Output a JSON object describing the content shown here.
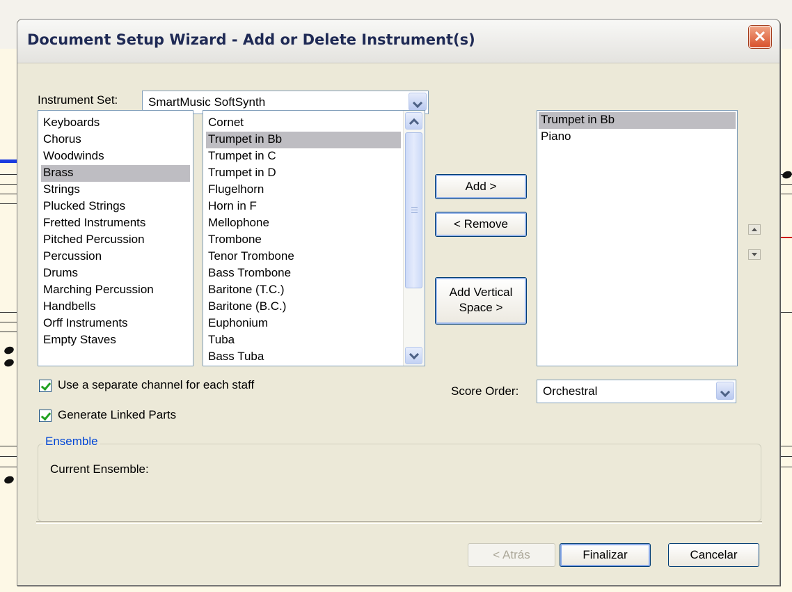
{
  "window": {
    "title": "Document Setup Wizard - Add or Delete Instrument(s)",
    "close_glyph": "✕"
  },
  "instrument_set": {
    "label": "Instrument Set:",
    "value": "SmartMusic SoftSynth"
  },
  "categories": [
    {
      "label": "Keyboards",
      "selected": false
    },
    {
      "label": "Chorus",
      "selected": false
    },
    {
      "label": "Woodwinds",
      "selected": false
    },
    {
      "label": "Brass",
      "selected": true
    },
    {
      "label": "Strings",
      "selected": false
    },
    {
      "label": "Plucked Strings",
      "selected": false
    },
    {
      "label": "Fretted Instruments",
      "selected": false
    },
    {
      "label": "Pitched Percussion",
      "selected": false
    },
    {
      "label": "Percussion",
      "selected": false
    },
    {
      "label": "Drums",
      "selected": false
    },
    {
      "label": "Marching Percussion",
      "selected": false
    },
    {
      "label": "Handbells",
      "selected": false
    },
    {
      "label": "Orff Instruments",
      "selected": false
    },
    {
      "label": "Empty Staves",
      "selected": false
    }
  ],
  "instruments": [
    {
      "label": "Cornet",
      "selected": false
    },
    {
      "label": "Trumpet in Bb",
      "selected": true
    },
    {
      "label": "Trumpet in C",
      "selected": false
    },
    {
      "label": "Trumpet in D",
      "selected": false
    },
    {
      "label": "Flugelhorn",
      "selected": false
    },
    {
      "label": "Horn in F",
      "selected": false
    },
    {
      "label": "Mellophone",
      "selected": false
    },
    {
      "label": "Trombone",
      "selected": false
    },
    {
      "label": "Tenor Trombone",
      "selected": false
    },
    {
      "label": "Bass Trombone",
      "selected": false
    },
    {
      "label": "Baritone (T.C.)",
      "selected": false
    },
    {
      "label": "Baritone (B.C.)",
      "selected": false
    },
    {
      "label": "Euphonium",
      "selected": false
    },
    {
      "label": "Tuba",
      "selected": false
    },
    {
      "label": "Bass Tuba",
      "selected": false
    }
  ],
  "score_instruments": [
    {
      "label": "Trumpet in Bb",
      "selected": true
    },
    {
      "label": "Piano",
      "selected": false
    }
  ],
  "buttons": {
    "add": "Add >",
    "remove": "< Remove",
    "add_vertical_line1": "Add Vertical",
    "add_vertical_line2": "Space >",
    "back": "< Atrás",
    "finish": "Finalizar",
    "cancel": "Cancelar"
  },
  "options": {
    "separate_channel": {
      "label": "Use a separate channel for each staff",
      "checked": true
    },
    "linked_parts": {
      "label": "Generate Linked Parts",
      "checked": true
    }
  },
  "score_order": {
    "label": "Score Order:",
    "value": "Orchestral"
  },
  "ensemble": {
    "legend": "Ensemble",
    "current_label": "Current Ensemble:"
  },
  "colors": {
    "title_text": "#1f2a55",
    "selection": "#bebdc2",
    "group_legend": "#0046d5",
    "close_button": "#d8502b"
  }
}
